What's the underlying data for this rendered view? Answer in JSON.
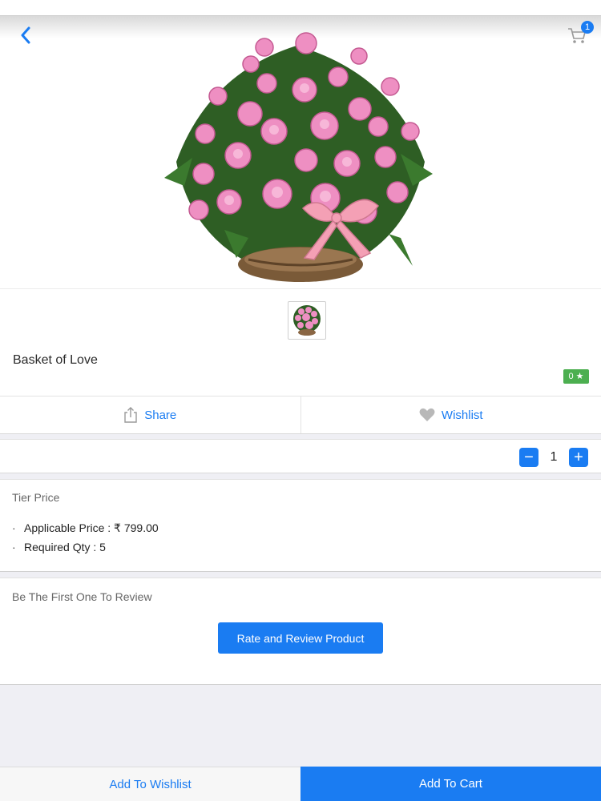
{
  "header": {
    "cart_count": "1"
  },
  "product": {
    "name": "Basket of Love",
    "rating": "0 ★"
  },
  "actions": {
    "share_label": "Share",
    "wishlist_label": "Wishlist"
  },
  "quantity": {
    "minus": "−",
    "value": "1",
    "plus": "+"
  },
  "tier_price": {
    "title": "Tier Price",
    "applicable_price": "Applicable Price : ₹ 799.00",
    "required_qty": "Required Qty : 5"
  },
  "review": {
    "title": "Be The First One To Review",
    "button_label": "Rate and Review Product"
  },
  "bottom_bar": {
    "add_to_wishlist": "Add To Wishlist",
    "add_to_cart": "Add To Cart"
  },
  "colors": {
    "accent": "#1a7cf2",
    "rating_badge": "#4caf50",
    "background": "#efeff4"
  },
  "icons": {
    "back": "back-chevron-icon",
    "cart": "cart-icon",
    "share": "share-icon",
    "wishlist": "heart-icon"
  }
}
